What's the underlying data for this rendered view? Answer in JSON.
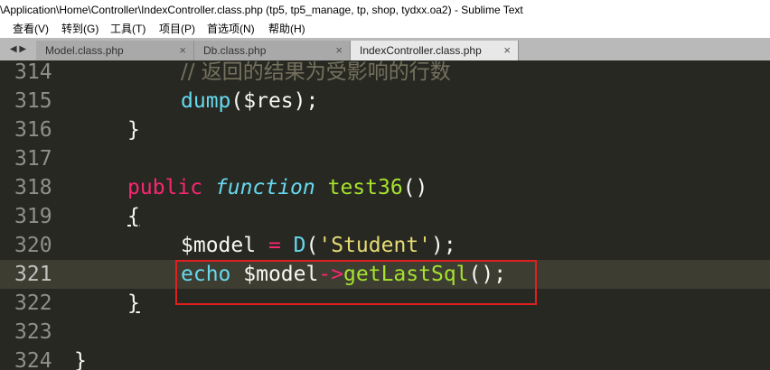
{
  "window": {
    "title": "\\Application\\Home\\Controller\\IndexController.class.php (tp5, tp5_manage, tp, shop, tydxx.oa2) - Sublime Text"
  },
  "menu": [
    "查看(V)",
    "转到(G)",
    "工具(T)",
    "项目(P)",
    "首选项(N)",
    "帮助(H)"
  ],
  "tabs": {
    "nav_arrows": "◀ ▶",
    "items": [
      {
        "label": "Model.class.php",
        "close": "×",
        "active": false
      },
      {
        "label": "Db.class.php",
        "close": "×",
        "active": false
      },
      {
        "label": "IndexController.class.php",
        "close": "×",
        "active": true
      }
    ]
  },
  "editor": {
    "current_line": "321",
    "lines": [
      {
        "n": "314",
        "tokens": [
          "// 返回的结果为受影响的行数"
        ]
      },
      {
        "n": "315",
        "tokens": [
          "dump",
          "(",
          "$res",
          ");"
        ]
      },
      {
        "n": "316",
        "tokens": [
          "}"
        ]
      },
      {
        "n": "317",
        "tokens": []
      },
      {
        "n": "318",
        "tokens": [
          "public",
          "function",
          "test36",
          "()"
        ]
      },
      {
        "n": "319",
        "tokens": [
          "{"
        ]
      },
      {
        "n": "320",
        "tokens": [
          "$model",
          "=",
          "D",
          "(",
          "'Student'",
          ");"
        ]
      },
      {
        "n": "321",
        "tokens": [
          "echo",
          "$model",
          "->",
          "getLastSql",
          "();"
        ]
      },
      {
        "n": "322",
        "tokens": [
          "}"
        ]
      },
      {
        "n": "323",
        "tokens": []
      },
      {
        "n": "324",
        "tokens": [
          "}"
        ]
      }
    ]
  },
  "colors": {
    "background": "#272822",
    "comment": "#75715e",
    "keyword": "#f92672",
    "storage": "#66d9ef",
    "function_name": "#a6e22e",
    "string": "#e6db74",
    "highlight_box": "#e02020"
  }
}
